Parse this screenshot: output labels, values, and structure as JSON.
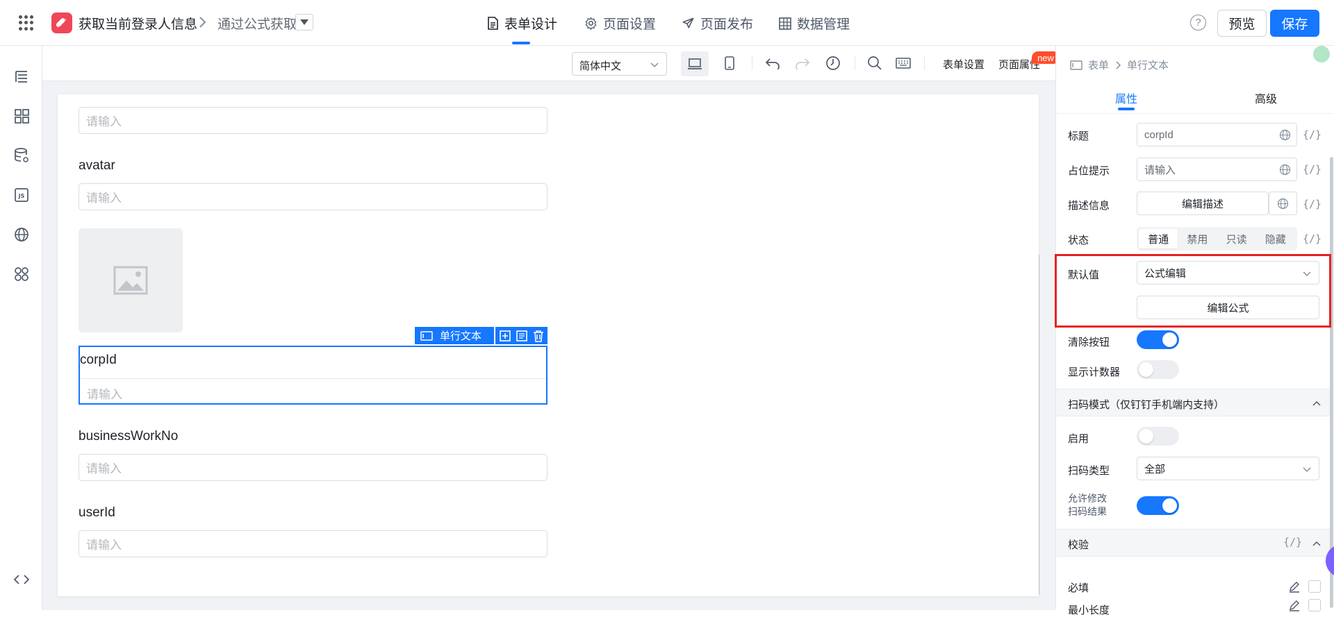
{
  "header": {
    "app_title": "获取当前登录人信息",
    "sub_page": "通过公式获取",
    "tabs": [
      {
        "label": "表单设计",
        "icon": "file-icon"
      },
      {
        "label": "页面设置",
        "icon": "gear-icon"
      },
      {
        "label": "页面发布",
        "icon": "send-icon"
      },
      {
        "label": "数据管理",
        "icon": "table-icon"
      }
    ],
    "help": "?",
    "preview_label": "预览",
    "save_label": "保存"
  },
  "sidebar": {
    "icons": [
      "outline-icon",
      "components-icon",
      "datasource-icon",
      "js-icon",
      "globe-icon",
      "plugins-icon",
      "code-icon"
    ]
  },
  "toolbar": {
    "language": "简体中文",
    "form_settings": "表单设置",
    "page_properties": "页面属性",
    "new_badge": "new"
  },
  "canvas": {
    "fields": [
      {
        "label": "",
        "placeholder": "请输入"
      },
      {
        "label": "avatar",
        "placeholder": "请输入"
      },
      {
        "label": "corpId",
        "placeholder": "请输入"
      },
      {
        "label": "businessWorkNo",
        "placeholder": "请输入"
      },
      {
        "label": "userId",
        "placeholder": "请输入"
      }
    ],
    "selected_tag": "单行文本"
  },
  "panel": {
    "breadcrumb": {
      "root": "表单",
      "current": "单行文本"
    },
    "tabs": {
      "properties": "属性",
      "advanced": "高级"
    },
    "fx": "{/}",
    "title": {
      "label": "标题",
      "value": "corpId"
    },
    "placeholder": {
      "label": "占位提示",
      "value": "请输入"
    },
    "description": {
      "label": "描述信息",
      "button": "编辑描述"
    },
    "state": {
      "label": "状态",
      "options": [
        "普通",
        "禁用",
        "只读",
        "隐藏"
      ],
      "selected": "普通"
    },
    "default_value": {
      "label": "默认值",
      "mode": "公式编辑",
      "button": "编辑公式"
    },
    "clear_button": {
      "label": "清除按钮",
      "on": true
    },
    "show_counter": {
      "label": "显示计数器",
      "on": false
    },
    "scan_section": {
      "title": "扫码模式（仅钉钉手机端内支持）",
      "enable": {
        "label": "启用",
        "on": false
      },
      "scan_type": {
        "label": "扫码类型",
        "value": "全部"
      },
      "allow_edit": {
        "label_line1": "允许修改",
        "label_line2": "扫码结果",
        "on": true
      }
    },
    "validation_section": {
      "title": "校验",
      "required": "必填",
      "min_length": "最小长度"
    }
  }
}
